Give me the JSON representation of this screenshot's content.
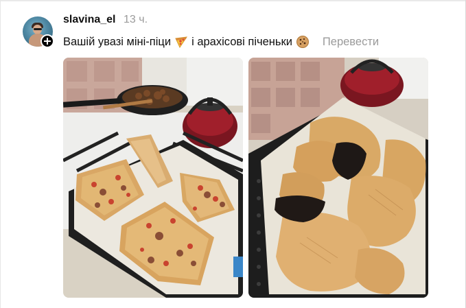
{
  "post": {
    "username": "slavina_el",
    "timestamp": "13 ч.",
    "caption_part1": "Вашій увазі міні-піци",
    "caption_part2": "і арахісові піченьки",
    "pizza_emoji": "pizza-emoji",
    "cookie_emoji": "cookie-emoji",
    "translate_label": "Перевести"
  },
  "colors": {
    "text": "#101010",
    "muted": "#9a9a9a",
    "background": "#ffffff"
  },
  "photos": [
    {
      "id": "photo-mini-pizzas"
    },
    {
      "id": "photo-peanut-cookies"
    }
  ]
}
